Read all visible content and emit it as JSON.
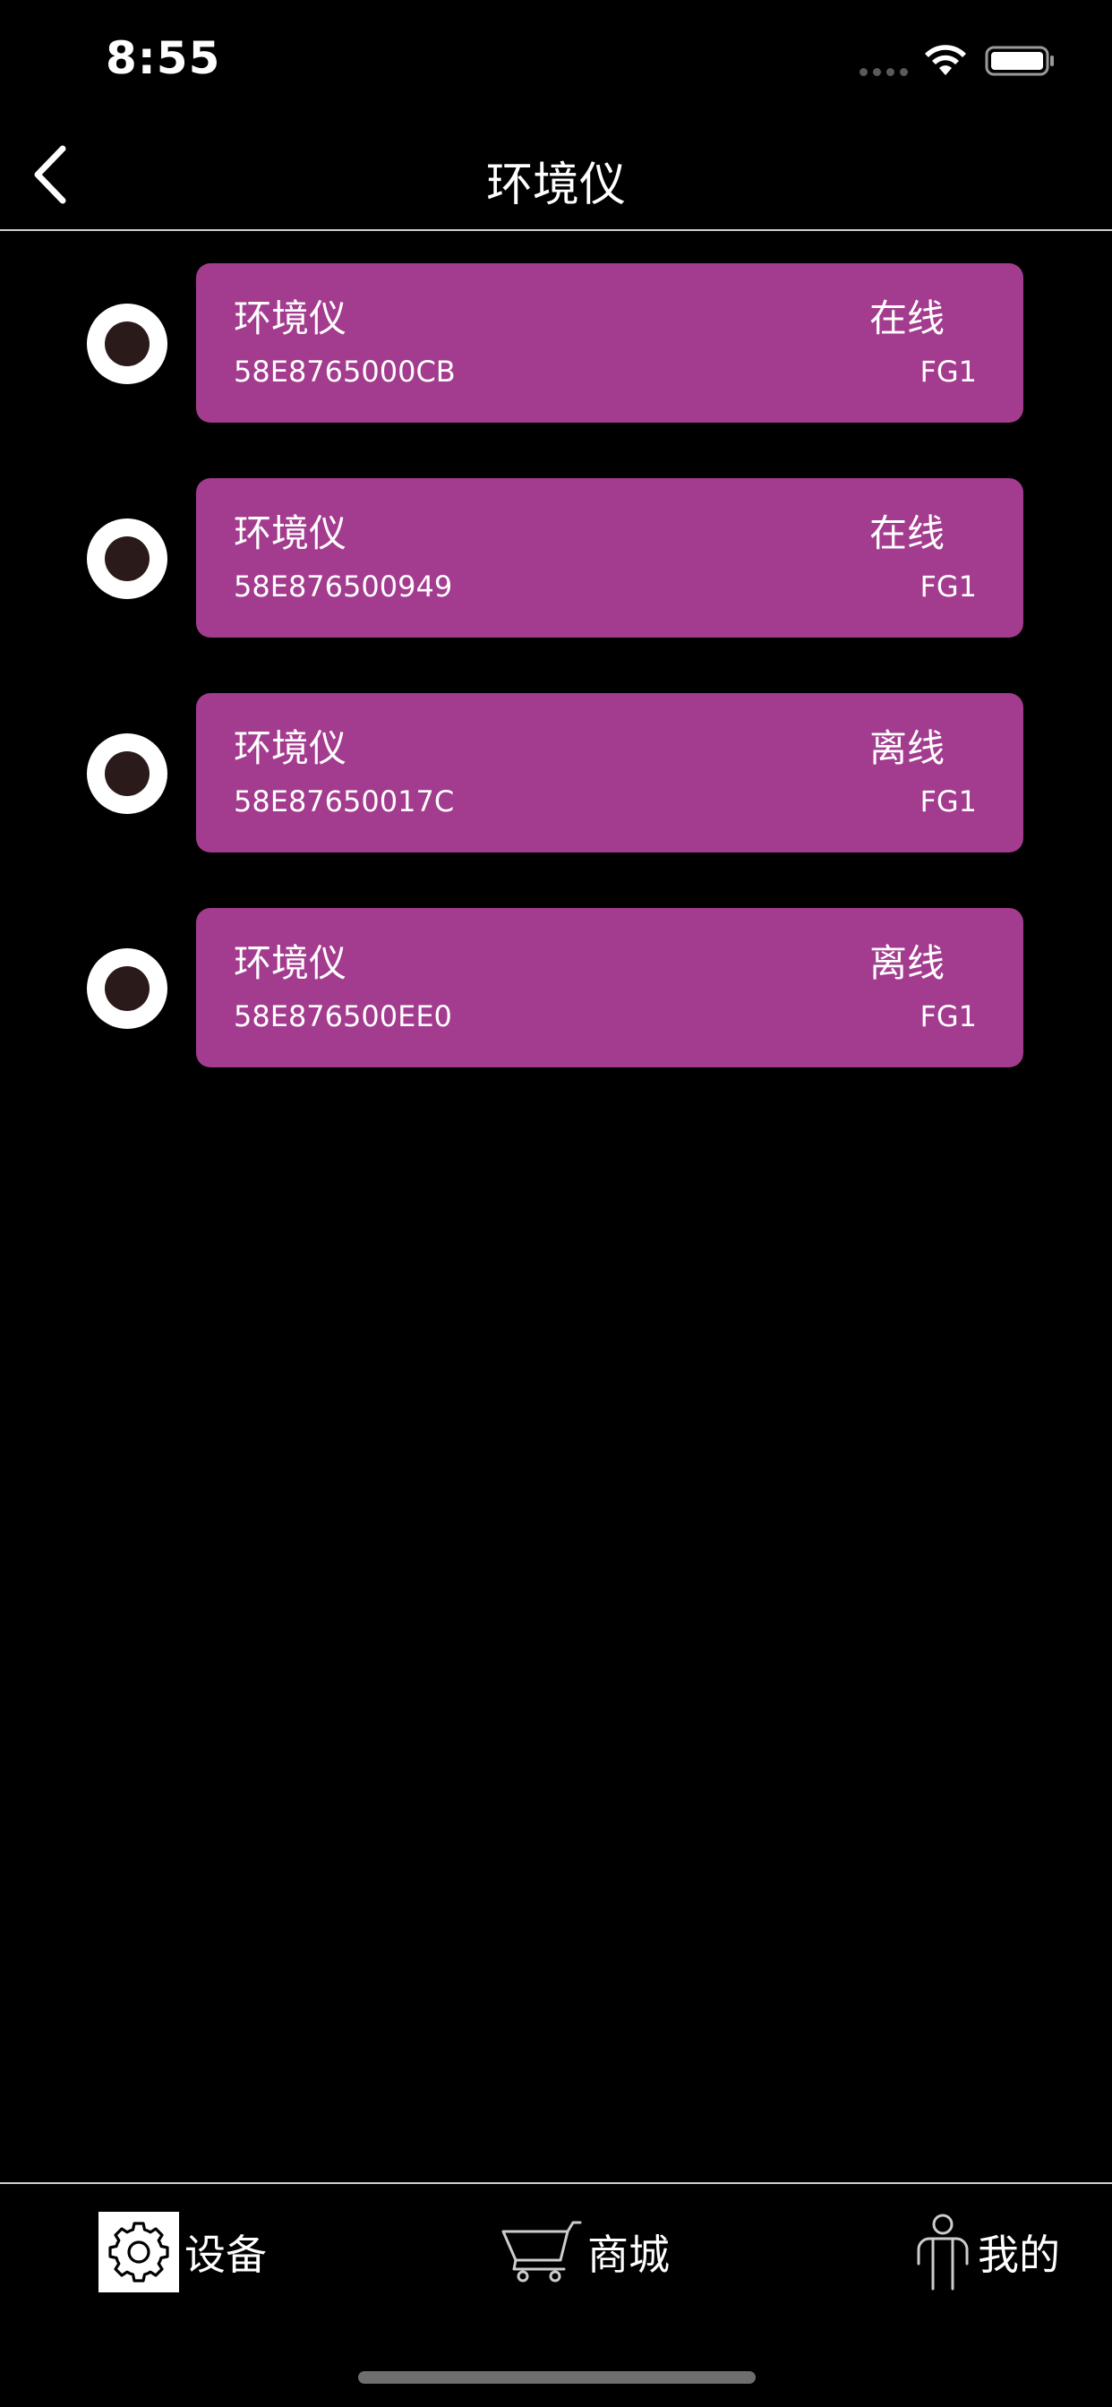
{
  "status_bar": {
    "time": "8:55"
  },
  "nav": {
    "title": "环境仪",
    "back_icon": "chevron-left-icon"
  },
  "devices": [
    {
      "name": "环境仪",
      "status": "在线",
      "id": "58E8765000CB",
      "model": "FG1"
    },
    {
      "name": "环境仪",
      "status": "在线",
      "id": "58E876500949",
      "model": "FG1"
    },
    {
      "name": "环境仪",
      "status": "离线",
      "id": "58E87650017C",
      "model": "FG1"
    },
    {
      "name": "环境仪",
      "status": "离线",
      "id": "58E876500EE0",
      "model": "FG1"
    }
  ],
  "tabs": [
    {
      "label": "设备",
      "icon": "gear-icon"
    },
    {
      "label": "商城",
      "icon": "cart-icon"
    },
    {
      "label": "我的",
      "icon": "person-icon"
    }
  ],
  "colors": {
    "background": "#000000",
    "card": "#a33b8e",
    "text": "#ffffff",
    "radio_fill": "#2a1a1a"
  }
}
